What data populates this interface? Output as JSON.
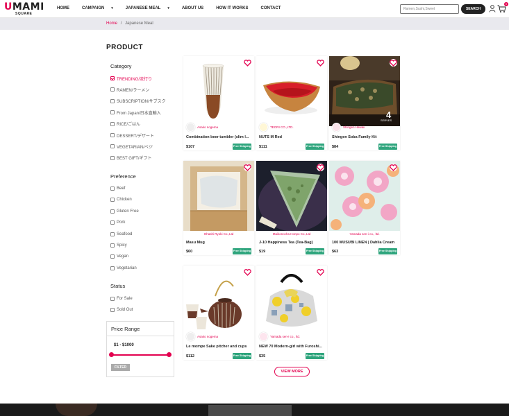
{
  "header": {
    "logo_main": "UMAMI",
    "logo_sub": "SQUARE",
    "nav": [
      {
        "label": "HOME",
        "dropdown": false
      },
      {
        "label": "CAMPAIGN",
        "dropdown": true
      },
      {
        "label": "JAPANESE MEAL",
        "dropdown": true
      },
      {
        "label": "ABOUT US",
        "dropdown": false
      },
      {
        "label": "HOW IT WORKS",
        "dropdown": false
      },
      {
        "label": "CONTACT",
        "dropdown": false
      }
    ],
    "search_placeholder": "Ramen,Sushi,Sweet",
    "search_button": "SEARCH",
    "cart_count": "0"
  },
  "breadcrumb": {
    "home": "Home",
    "separator": "/",
    "current": "Japanese Meal"
  },
  "sidebar": {
    "title": "PRODUCT",
    "category_title": "Category",
    "categories": [
      {
        "label": "TRENDING/流行り",
        "checked": true
      },
      {
        "label": "RAMEN/ラーメン",
        "checked": false
      },
      {
        "label": "SUBSCRIPTION/サブスク",
        "checked": false
      },
      {
        "label": "From Japan/日本直輸入",
        "checked": false
      },
      {
        "label": "RICE/ごはん",
        "checked": false
      },
      {
        "label": "DESSERT/デザート",
        "checked": false
      },
      {
        "label": "VEGETARIAN/ベジ",
        "checked": false
      },
      {
        "label": "BEST GIFT/ギフト",
        "checked": false
      }
    ],
    "preference_title": "Preference",
    "preferences": [
      "Beef",
      "Chicken",
      "Gluten Free",
      "Pork",
      "Seafood",
      "Spicy",
      "Vegan",
      "Vegetarian"
    ],
    "status_title": "Status",
    "statuses": [
      "For Sale",
      "Sold Out"
    ],
    "price_title": "Price Range",
    "price_value": "$1 - $1000",
    "filter_button": "FILTER"
  },
  "products": [
    {
      "seller": "Asako nogema",
      "name": "Combination beer tumbler (slim l...",
      "price": "$107",
      "shipping": "Free Shipping"
    },
    {
      "seller": "TEORI CO.,LTD.",
      "name": "NUTS M Red",
      "price": "$111",
      "shipping": "Free Shipping"
    },
    {
      "seller": "Shingen Hawaii",
      "name": "Shingen Soba Family Kit",
      "price": "$84",
      "shipping": "Free Shipping"
    },
    {
      "seller": "Ohashi Ryoki Co.,Ltd",
      "name": "Masu Mug",
      "price": "$60",
      "shipping": "Free Shipping"
    },
    {
      "seller": "Maikonocha Honpo Co.,Ltd",
      "name": "J-10 Happiness Tea (Tea-Bag)",
      "price": "$19",
      "shipping": "Free Shipping"
    },
    {
      "seller": "Yamada sen-i co., ltd.",
      "name": "100 MUSUBI LINEN | Dahlia Cream",
      "price": "$63",
      "shipping": "Free Shipping"
    },
    {
      "seller": "Asako nogema",
      "name": "Le mompe Sake pitcher and cups",
      "price": "$112",
      "shipping": "Free Shipping"
    },
    {
      "seller": "Yamada sen-i co., ltd.",
      "name": "NEW 70 Modern-girl with Furoshi...",
      "price": "$35",
      "shipping": "Free Shipping"
    }
  ],
  "view_more": "VIEW MORE",
  "image_texts": {
    "soba_serves": "SERVES"
  },
  "colors": {
    "accent": "#e3004f",
    "shipping_badge": "#2fa57d",
    "header_bg": "#ffffff",
    "breadcrumb_bg": "#e9e9ee"
  }
}
